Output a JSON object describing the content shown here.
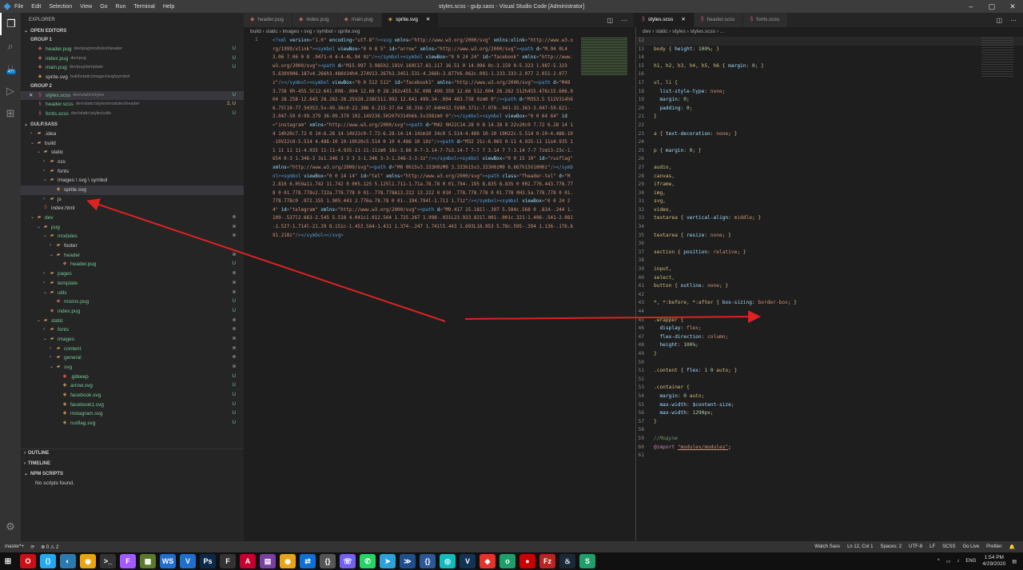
{
  "window": {
    "title": "styles.scss - gulp.sass - Visual Studio Code [Administrator]",
    "menu": [
      "File",
      "Edit",
      "Selection",
      "View",
      "Go",
      "Run",
      "Terminal",
      "Help"
    ]
  },
  "activity": {
    "scm_badge": "477"
  },
  "explorer": {
    "title": "EXPLORER",
    "open_editors": "OPEN EDITORS",
    "group1": "GROUP 1",
    "group1_files": [
      {
        "name": "header.pug",
        "path": "dev\\pug\\modules\\header",
        "status": "U"
      },
      {
        "name": "index.pug",
        "path": "dev\\pug",
        "status": "U"
      },
      {
        "name": "main.pug",
        "path": "dev\\pug\\template",
        "status": "U"
      },
      {
        "name": "sprite.svg",
        "path": "build\\static\\images\\svg\\symbol",
        "status": ""
      }
    ],
    "group2": "GROUP 2",
    "group2_files": [
      {
        "name": "styles.scss",
        "path": "dev\\static\\styles",
        "status": "U"
      },
      {
        "name": "header.scss",
        "path": "dev\\static\\styles\\modules\\header",
        "status": "2, U"
      },
      {
        "name": "fonts.scss",
        "path": "dev\\static\\styles\\utils",
        "status": "U"
      }
    ],
    "project": "GULP.SASS",
    "tree": [
      {
        "name": ".idea",
        "indent": 1,
        "kind": "folder",
        "open": false,
        "status": ""
      },
      {
        "name": "build",
        "indent": 1,
        "kind": "folder",
        "open": true,
        "status": ""
      },
      {
        "name": "static",
        "indent": 2,
        "kind": "folder",
        "open": true,
        "status": ""
      },
      {
        "name": "css",
        "indent": 3,
        "kind": "folder",
        "open": false,
        "status": ""
      },
      {
        "name": "fonts",
        "indent": 3,
        "kind": "folder",
        "open": false,
        "status": ""
      },
      {
        "name": "images \\ svg \\ symbol",
        "indent": 3,
        "kind": "folder",
        "open": true,
        "status": ""
      },
      {
        "name": "sprite.svg",
        "indent": 4,
        "kind": "svg",
        "open": false,
        "status": "",
        "selected": true
      },
      {
        "name": "js",
        "indent": 3,
        "kind": "folder",
        "open": false,
        "status": ""
      },
      {
        "name": "index.html",
        "indent": 2,
        "kind": "html",
        "open": false,
        "status": ""
      },
      {
        "name": "dev",
        "indent": 1,
        "kind": "folder",
        "open": true,
        "status": "dot"
      },
      {
        "name": "pug",
        "indent": 2,
        "kind": "folder",
        "open": true,
        "status": "dot"
      },
      {
        "name": "modules",
        "indent": 3,
        "kind": "folder",
        "open": true,
        "status": "dot"
      },
      {
        "name": "footer",
        "indent": 4,
        "kind": "folder",
        "open": false,
        "status": ""
      },
      {
        "name": "header",
        "indent": 4,
        "kind": "folder",
        "open": true,
        "status": "dot"
      },
      {
        "name": "header.pug",
        "indent": 5,
        "kind": "pug",
        "open": false,
        "status": "U"
      },
      {
        "name": "pages",
        "indent": 3,
        "kind": "folder",
        "open": false,
        "status": "dot"
      },
      {
        "name": "template",
        "indent": 3,
        "kind": "folder",
        "open": false,
        "status": "dot"
      },
      {
        "name": "utils",
        "indent": 3,
        "kind": "folder",
        "open": true,
        "status": "dot"
      },
      {
        "name": "mixins.pug",
        "indent": 4,
        "kind": "pug",
        "open": false,
        "status": "U"
      },
      {
        "name": "index.pug",
        "indent": 3,
        "kind": "pug",
        "open": false,
        "status": "U"
      },
      {
        "name": "static",
        "indent": 2,
        "kind": "folder",
        "open": true,
        "status": "dot"
      },
      {
        "name": "fonts",
        "indent": 3,
        "kind": "folder",
        "open": false,
        "status": "dot"
      },
      {
        "name": "images",
        "indent": 3,
        "kind": "folder",
        "open": true,
        "status": "dot"
      },
      {
        "name": "content",
        "indent": 4,
        "kind": "folder",
        "open": false,
        "status": "dot"
      },
      {
        "name": "general",
        "indent": 4,
        "kind": "folder",
        "open": false,
        "status": "dot"
      },
      {
        "name": "svg",
        "indent": 4,
        "kind": "folder",
        "open": true,
        "status": "dot"
      },
      {
        "name": ".gitkeep",
        "indent": 5,
        "kind": "git",
        "open": false,
        "status": "U"
      },
      {
        "name": "arrow.svg",
        "indent": 5,
        "kind": "svg",
        "open": false,
        "status": "U"
      },
      {
        "name": "facebook.svg",
        "indent": 5,
        "kind": "svg",
        "open": false,
        "status": "U"
      },
      {
        "name": "facebook1.svg",
        "indent": 5,
        "kind": "svg",
        "open": false,
        "status": "U"
      },
      {
        "name": "instagram.svg",
        "indent": 5,
        "kind": "svg",
        "open": false,
        "status": "U"
      },
      {
        "name": "rusflag.svg",
        "indent": 5,
        "kind": "svg",
        "open": false,
        "status": "U"
      }
    ],
    "outline": "OUTLINE",
    "timeline": "TIMELINE",
    "npm": "NPM SCRIPTS",
    "npm_empty": "No scripts found."
  },
  "editor1": {
    "tabs": [
      {
        "label": "header.pug",
        "active": false
      },
      {
        "label": "index.pug",
        "active": false
      },
      {
        "label": "main.pug",
        "active": false
      },
      {
        "label": "sprite.svg",
        "active": true
      }
    ],
    "breadcrumb": "build › static › images › svg › symbol › sprite.svg",
    "line_number": "1",
    "code": "<?xml version=\"1.0\" encoding=\"utf-8\"?><svg xmlns=\"http://www.w3.org/2000/svg\" xmlns:xlink=\"http://www.w3.org/1999/xlink\"><symbol viewBox=\"0 0 8 5\" id=\"arrow\" xmlns=\"http://www.w3.org/2000/svg\"><path d=\"M.94 0L4 3.06 7.06 0 8 .9471-4 4-4-4L.94 0z\"/></symbol><symbol viewBox=\"0 0 24 24\" id=\"facebook\" xmlns=\"http://www.w3.org/2000/svg\"><path d=\"M15.997 3.985h2.191V.169C17.81.117 16.51 0 14.996 0c-3.159 0-5.323 1.987-5.323 5.639V9H6.187v4.266h3.486V24h4.274V13.267h3.3451.531-4.266h-3.877V6.062c.001-1.233.333-2.077 2.051-2.077z\"/></symbol><symbol viewBox=\"0 0 512 512\" id=\"facebook1\" xmlns=\"http://www.w3.org/2000/svg\"><path d=\"M483.738 0h-455.5C12.641.008-.004 12.66 0 28.262v455.5C.008 499.359 12.66 512.004 28.262 512h455.476c15.606.004 28.258-12.645 28.262-28.25V28.238C511.992 12.641 499.34-.004 483.738 0zm0 0\"/><path d=\"M353.5 512V314h66.75l10-77.5H353.5v-49.36c0-22.386 6.215-37.64 38.316-37.64H432.5V80.371c-7.078-.941-31.363-3.047-59.621-3.047-59 0-99.379 36-99.379 102.14V236.5H207V314h66.5v198zm0 0\"/></symbol><symbol viewBox=\"0 0 64 64\" id=\"instagram\" xmlns=\"http://www.w3.org/2000/svg\"><path d=\"M42 0H22C14.28 0 8 14.28 8 22v20c0 7.72 6.28 14 14 14h20c7.72 0 14-6.28 14-14V22c0-7.72-6.28-14-14-14zm10 34c0 5.514-4.486 10-10 10H22c-5.514 0-10-4.486-10-10V22c0-5.514 4.486-10 10-10h20c5.514 0 10 4.486 10 10z\"/><path d=\"M32 21c-6.065 0-11 4.935-11 11s4.935 11 11 11 11-4.935 11-11-4.935-11-11-11zm0 18c-3.86 0-7-3.14-7-7s3.14-7 7-7 7 3.14 7 7-3.14 7-7 7zm13-23c-1.654 0-3 1.346-3 3s1.346 3 3 3 3-1.346 3-3-1.346-3-3-3z\"/></symbol><symbol viewBox=\"0 0 15 10\" id=\"rusflag\" xmlns=\"http://www.w3.org/2000/svg\"><path d=\"M0 0h15v3.333H0zM0 3.333h15v3.333H0zM0 6.667h15V10H0z\"/></symbol><symbol viewBox=\"0 0 14 14\" id=\"tel\" xmlns=\"http://www.w3.org/2000/svg\"><path class=\"fheader-tel\" d=\"M2.816 6.059a11.742 11.742 0 005.125 5.125l1.711-1.71a.78.78 0 01.794-.195 8.835 8.835 0 002.776.443.778.778 0 01.778.778v2.722a.778.778 0 01-.778.778A13.222 13.222 0 010 .778.778.778 0 01.778 0H3.5a.778.778 0 01.778.778c0 .972.155 1.905.443 2.776a.78.78 0 01-.194.794l-1.711 1.71z\"/></symbol><symbol viewBox=\"0 0 24 24\" id=\"telegram\" xmlns=\"http://www.w3.org/2000/svg\"><path d=\"M9.417 15.181l-.397 5.584c.568 0 .814-.244 1.109-.537l2.663-2.545 5.518 4.041c1.012.564 1.725.267 1.998-.931L23.933.821l.001-.001c.321-1.496-.541-2.081-1.527-1.714l-21.29 8.151c-1.453.564-1.431 1.374-.247 1.741l5.443 1.693L18.953 5.78c.595-.394 1.136-.176.691.218z\"/></symbol></svg>"
  },
  "editor2": {
    "tabs": [
      {
        "label": "styles.scss",
        "active": true
      },
      {
        "label": "header.scss",
        "active": false
      },
      {
        "label": "fonts.scss",
        "active": false
      }
    ],
    "breadcrumb": "dev › static › styles › styles.scss › ...",
    "lines": [
      {
        "n": "12",
        "t": ""
      },
      {
        "n": "13",
        "t": "body { height: 100%; }"
      },
      {
        "n": "14",
        "t": ""
      },
      {
        "n": "15",
        "t": "h1, h2, h3, h4, h5, h6 { margin: 0; }"
      },
      {
        "n": "16",
        "t": ""
      },
      {
        "n": "17",
        "t": "ul, li {"
      },
      {
        "n": "18",
        "t": "  list-style-type: none;"
      },
      {
        "n": "19",
        "t": "  margin: 0;"
      },
      {
        "n": "20",
        "t": "  padding: 0;"
      },
      {
        "n": "21",
        "t": "}"
      },
      {
        "n": "22",
        "t": ""
      },
      {
        "n": "23",
        "t": "a { text-decoration: none; }"
      },
      {
        "n": "24",
        "t": ""
      },
      {
        "n": "25",
        "t": "p { margin: 0; }"
      },
      {
        "n": "26",
        "t": ""
      },
      {
        "n": "27",
        "t": "audio,"
      },
      {
        "n": "28",
        "t": "canvas,"
      },
      {
        "n": "29",
        "t": "iframe,"
      },
      {
        "n": "30",
        "t": "img,"
      },
      {
        "n": "31",
        "t": "svg,"
      },
      {
        "n": "32",
        "t": "video,"
      },
      {
        "n": "33",
        "t": "textarea { vertical-align: middle; }"
      },
      {
        "n": "34",
        "t": ""
      },
      {
        "n": "35",
        "t": "textarea { resize: none; }"
      },
      {
        "n": "36",
        "t": ""
      },
      {
        "n": "37",
        "t": "section { position: relative; }"
      },
      {
        "n": "38",
        "t": ""
      },
      {
        "n": "39",
        "t": "input,"
      },
      {
        "n": "40",
        "t": "select,"
      },
      {
        "n": "41",
        "t": "button { outline: none; }"
      },
      {
        "n": "42",
        "t": ""
      },
      {
        "n": "43",
        "t": "*, *:before, *:after { box-sizing: border-box; }"
      },
      {
        "n": "44",
        "t": ""
      },
      {
        "n": "45",
        "t": ".wrapper {"
      },
      {
        "n": "46",
        "t": "  display: flex;"
      },
      {
        "n": "47",
        "t": "  flex-direction: column;"
      },
      {
        "n": "48",
        "t": "  height: 100%;"
      },
      {
        "n": "49",
        "t": "}"
      },
      {
        "n": "50",
        "t": ""
      },
      {
        "n": "51",
        "t": ".content { flex: 1 0 auto; }"
      },
      {
        "n": "52",
        "t": ""
      },
      {
        "n": "53",
        "t": ".container {"
      },
      {
        "n": "54",
        "t": "  margin: 0 auto;"
      },
      {
        "n": "55",
        "t": "  max-width: $content-size;"
      },
      {
        "n": "56",
        "t": "  max-width: 1290px;"
      },
      {
        "n": "57",
        "t": "}"
      },
      {
        "n": "58",
        "t": ""
      },
      {
        "n": "59",
        "t": "//Модули"
      },
      {
        "n": "60",
        "t": "@import \"modules/modules\";"
      },
      {
        "n": "61",
        "t": ""
      }
    ]
  },
  "status": {
    "branch": "master*+",
    "sync": "⟳",
    "problems": "⊗ 0 ⚠ 2",
    "watch": "Watch Sass",
    "position": "Ln 12, Col 1",
    "spaces": "Spaces: 2",
    "encoding": "UTF-8",
    "eol": "LF",
    "lang": "SCSS",
    "golive": "Go Live",
    "prettier": "Prettier"
  },
  "taskbar": {
    "lang": "ENG",
    "time": "1:54 PM",
    "date": "4/29/2020",
    "apps": [
      {
        "icon": "opera-icon",
        "color": "#cc0f16",
        "glyph": "O"
      },
      {
        "icon": "vscode-icon",
        "color": "#23a9f2",
        "glyph": "⟨⟩"
      },
      {
        "icon": "browser-icon",
        "color": "#2a7ab0",
        "glyph": "◐"
      },
      {
        "icon": "chrome-icon",
        "color": "#e8a317",
        "glyph": "◉"
      },
      {
        "icon": "terminal-icon",
        "color": "#333",
        "glyph": ">_"
      },
      {
        "icon": "figma-icon",
        "color": "#a259ff",
        "glyph": "F"
      },
      {
        "icon": "app-icon",
        "color": "#5a7a2a",
        "glyph": "▩"
      },
      {
        "icon": "webstorm-icon",
        "color": "#1f6fd0",
        "glyph": "WS"
      },
      {
        "icon": "vs-icon",
        "color": "#1f6fd0",
        "glyph": "V"
      },
      {
        "icon": "photoshop-icon",
        "color": "#0b2a4a",
        "glyph": "Ps"
      },
      {
        "icon": "figma2-icon",
        "color": "#333",
        "glyph": "F"
      },
      {
        "icon": "angular-icon",
        "color": "#c3002f",
        "glyph": "A"
      },
      {
        "icon": "archive-icon",
        "color": "#7b3fa0",
        "glyph": "▤"
      },
      {
        "icon": "chrome2-icon",
        "color": "#e8a317",
        "glyph": "◉"
      },
      {
        "icon": "teamviewer-icon",
        "color": "#0e6fd6",
        "glyph": "⇄"
      },
      {
        "icon": "code-icon",
        "color": "#555",
        "glyph": "{}"
      },
      {
        "icon": "viber-icon",
        "color": "#7360f2",
        "glyph": "☏"
      },
      {
        "icon": "whatsapp-icon",
        "color": "#25d366",
        "glyph": "✆"
      },
      {
        "icon": "telegram-icon",
        "color": "#2aa1da",
        "glyph": "➤"
      },
      {
        "icon": "powershell-icon",
        "color": "#1f4e8c",
        "glyph": "≫"
      },
      {
        "icon": "braces-icon",
        "color": "#2b5797",
        "glyph": "{}"
      },
      {
        "icon": "sync-icon",
        "color": "#1bb",
        "glyph": "◎"
      },
      {
        "icon": "vim-icon",
        "color": "#135",
        "glyph": "V"
      },
      {
        "icon": "anydesk-icon",
        "color": "#e2342a",
        "glyph": "◆"
      },
      {
        "icon": "app2-icon",
        "color": "#1e9e6b",
        "glyph": "o"
      },
      {
        "icon": "record-icon",
        "color": "#c00",
        "glyph": "●"
      },
      {
        "icon": "filezilla-icon",
        "color": "#b22",
        "glyph": "Fz"
      },
      {
        "icon": "steam-icon",
        "color": "#1b2838",
        "glyph": "♨"
      },
      {
        "icon": "app3-icon",
        "color": "#1e9e6b",
        "glyph": "S"
      }
    ]
  }
}
